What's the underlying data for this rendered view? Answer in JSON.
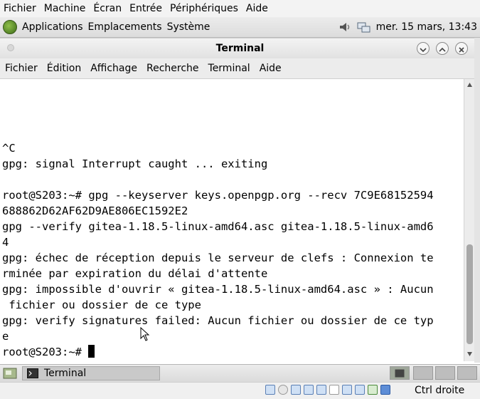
{
  "vbox_menu": [
    "Fichier",
    "Machine",
    "Écran",
    "Entrée",
    "Périphériques",
    "Aide"
  ],
  "panel": {
    "menus": [
      "Applications",
      "Emplacements",
      "Système"
    ],
    "clock": "mer. 15 mars, 13:43"
  },
  "window": {
    "title": "Terminal",
    "menu": [
      "Fichier",
      "Édition",
      "Affichage",
      "Recherche",
      "Terminal",
      "Aide"
    ]
  },
  "terminal_lines": [
    "^C",
    "gpg: signal Interrupt caught ... exiting",
    "",
    "root@S203:~# gpg --keyserver keys.openpgp.org --recv 7C9E68152594",
    "688862D62AF62D9AE806EC1592E2",
    "gpg --verify gitea-1.18.5-linux-amd64.asc gitea-1.18.5-linux-amd6",
    "4",
    "gpg: échec de réception depuis le serveur de clefs : Connexion te",
    "rminée par expiration du délai d'attente",
    "gpg: impossible d'ouvrir « gitea-1.18.5-linux-amd64.asc » : Aucun",
    " fichier ou dossier de ce type",
    "gpg: verify signatures failed: Aucun fichier ou dossier de ce typ",
    "e",
    "root@S203:~# "
  ],
  "taskbar": {
    "task_label": "Terminal"
  },
  "statusbar": {
    "host_key": "Ctrl droite"
  }
}
